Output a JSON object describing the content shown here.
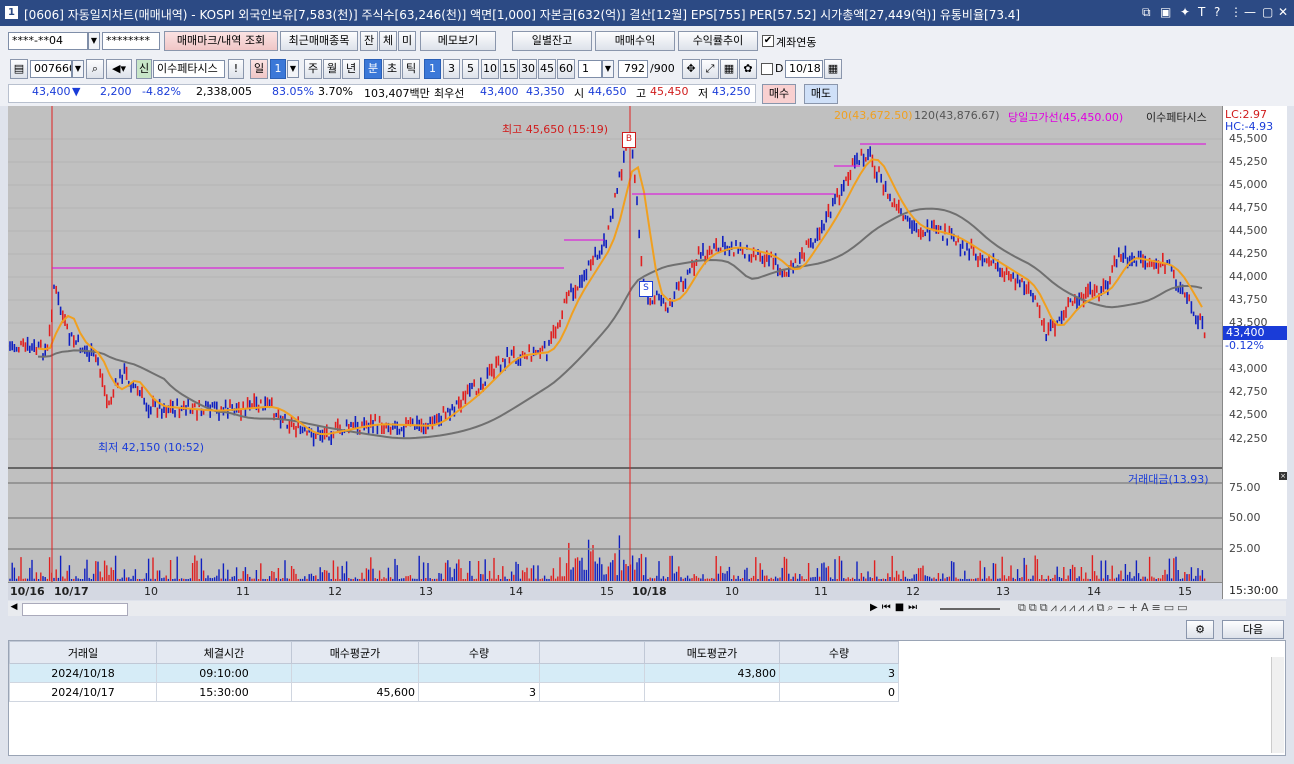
{
  "window": {
    "number": "1",
    "title": "[0606] 자동일지차트(매매내역) - KOSPI 외국인보유[7,583(천)] 주식수[63,246(천)] 액면[1,000] 자본금[632(억)] 결산[12월] EPS[755] PER[57.52] 시가총액[27,449(억)] 유통비율[73.4]"
  },
  "toolbar1": {
    "account": "****-**04",
    "password": "********",
    "trade_mark_btn": "매매마크/내역 조회",
    "recent_btn": "최근매매종목",
    "jan_btn": "잔",
    "che_btn": "체",
    "mi_btn": "미",
    "memo_btn": "메모보기",
    "daily_balance_btn": "일별잔고",
    "trade_profit_btn": "매매수익",
    "return_trend_btn": "수익률추이",
    "link_label": "계좌연동"
  },
  "toolbar2": {
    "code": "007660",
    "shin": "신",
    "stock_name": "이수페타시스",
    "period_il": "일",
    "period_num": "1",
    "period_ju": "주",
    "period_wol": "월",
    "period_nyeon": "년",
    "period_bun": "분",
    "period_cho": "초",
    "period_tick": "틱",
    "minutes": [
      "1",
      "3",
      "5",
      "10",
      "15",
      "30",
      "45",
      "60"
    ],
    "minute_custom": "1",
    "count": "792",
    "count_total": "/900",
    "d_label": "D",
    "date": "10/18"
  },
  "quote": {
    "price": "43,400",
    "arrow": "▼",
    "change": "2,200",
    "change_rate": "-4.82%",
    "volume": "2,338,005",
    "ratio": "83.05%",
    "rate2": "3.70%",
    "amount": "103,407백만",
    "best_label": "최우선",
    "ask": "43,400",
    "bid": "43,350",
    "open_label": "시",
    "open": "44,650",
    "high_label": "고",
    "high": "45,450",
    "low_label": "저",
    "low": "43,250",
    "buy_btn": "매수",
    "sell_btn": "매도"
  },
  "chart": {
    "legend": {
      "ma20": "20(43,672.50)",
      "ma120": "120(43,876.67)",
      "day_high": "당일고가선(45,450.00)",
      "name": "이수페타시스",
      "lc": "LC:2.97",
      "hc": "HC:-4.93"
    },
    "high_annot": "최고 45,650 (15:19)",
    "low_annot": "최저 42,150 (10:52)",
    "buy_mark": "B",
    "sell_mark": "S",
    "price_labels": [
      "45,500",
      "45,250",
      "45,000",
      "44,750",
      "44,500",
      "44,250",
      "44,000",
      "43,750",
      "43,500",
      "43,250",
      "43,000",
      "42,750",
      "42,500",
      "42,250"
    ],
    "current_price": "43,400",
    "current_change": "-0.12%",
    "volume_title": "거래대금(13.93)",
    "volume_labels": [
      "75.00",
      "50.00",
      "25.00"
    ],
    "x_labels": [
      "10/16",
      "10/17",
      "10",
      "11",
      "12",
      "13",
      "14",
      "15",
      "10/18",
      "10",
      "11",
      "12",
      "13",
      "14",
      "15"
    ],
    "time_label": "15:30:00",
    "colors": {
      "ma20": "#f0a020",
      "ma120": "#707070",
      "day_high": "#e000e0",
      "up": "#e02020",
      "down": "#1020c0"
    }
  },
  "bottom": {
    "next_btn": "다음",
    "headers": [
      "거래일",
      "체결시간",
      "매수평균가",
      "수량",
      "",
      "매도평균가",
      "수량"
    ],
    "rows": [
      [
        "2024/10/18",
        "09:10:00",
        "",
        "",
        "",
        "43,800",
        "3"
      ],
      [
        "2024/10/17",
        "15:30:00",
        "45,600",
        "3",
        "",
        "",
        "0"
      ]
    ]
  }
}
